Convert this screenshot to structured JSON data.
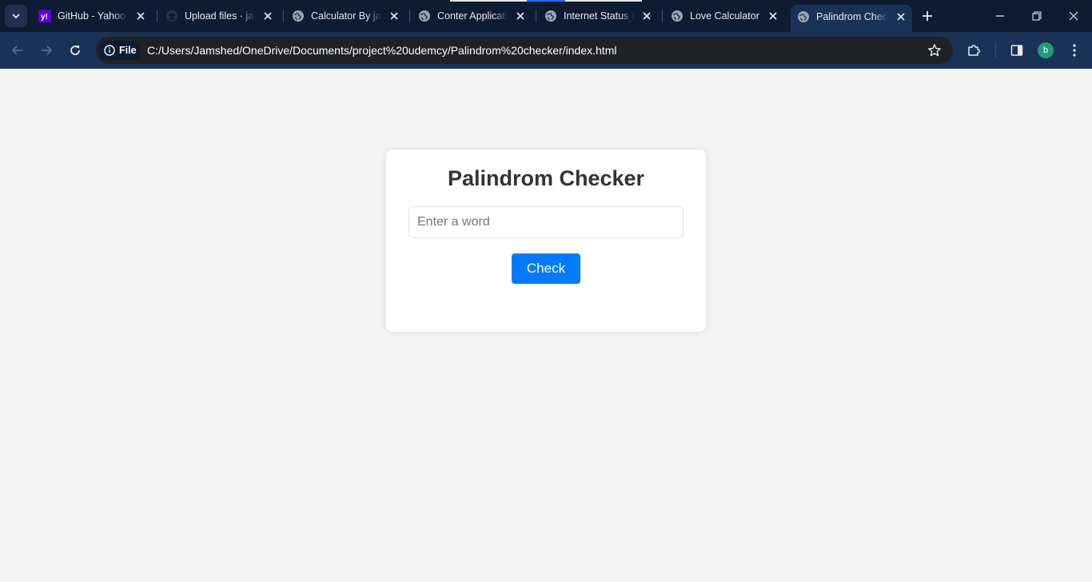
{
  "browser": {
    "tabs": [
      {
        "title": "GitHub - Yahoo Search",
        "favicon": "yahoo-icon",
        "active": false
      },
      {
        "title": "Upload files · jamshed",
        "favicon": "github-icon",
        "active": false
      },
      {
        "title": "Calculator By jamshed",
        "favicon": "globe-icon",
        "active": false
      },
      {
        "title": "Conter Application",
        "favicon": "globe-icon",
        "active": false
      },
      {
        "title": "Internet Status Checker",
        "favicon": "globe-icon",
        "active": false
      },
      {
        "title": "Love Calculator",
        "favicon": "globe-icon",
        "active": false
      },
      {
        "title": "Palindrom Checker",
        "favicon": "globe-icon",
        "active": true
      }
    ],
    "address_bar": {
      "chip_label": "File",
      "url": "C:/Users/Jamshed/OneDrive/Documents/project%20udemcy/Palindrom%20checker/index.html"
    },
    "profile_initial": "b",
    "colors": {
      "tabstrip_bg": "#0d1b33",
      "toolbar_bg": "#1b3257",
      "omnibox_bg": "#202124",
      "avatar_bg": "#1a9e7a"
    }
  },
  "page": {
    "title": "Palindrom Checker",
    "input": {
      "value": "",
      "placeholder": "Enter a word"
    },
    "button_label": "Check",
    "colors": {
      "background": "#f4f4f4",
      "card": "#ffffff",
      "title": "#333333",
      "button": "#007bff",
      "button_text": "#ffffff"
    }
  }
}
